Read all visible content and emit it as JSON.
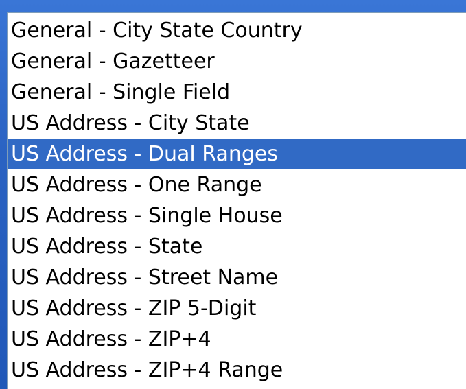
{
  "list": {
    "items": [
      {
        "label": "General - City State Country",
        "selected": false
      },
      {
        "label": "General - Gazetteer",
        "selected": false
      },
      {
        "label": "General - Single Field",
        "selected": false
      },
      {
        "label": "US Address - City State",
        "selected": false
      },
      {
        "label": "US Address - Dual Ranges",
        "selected": true
      },
      {
        "label": "US Address - One Range",
        "selected": false
      },
      {
        "label": "US Address - Single House",
        "selected": false
      },
      {
        "label": "US Address - State",
        "selected": false
      },
      {
        "label": "US Address - Street Name",
        "selected": false
      },
      {
        "label": "US Address - ZIP 5-Digit",
        "selected": false
      },
      {
        "label": "US Address - ZIP+4",
        "selected": false
      },
      {
        "label": "US Address - ZIP+4 Range",
        "selected": false
      }
    ]
  },
  "colors": {
    "selection_background": "#316ac5",
    "selection_text": "#ffffff",
    "window_frame": "#2a62c2"
  }
}
